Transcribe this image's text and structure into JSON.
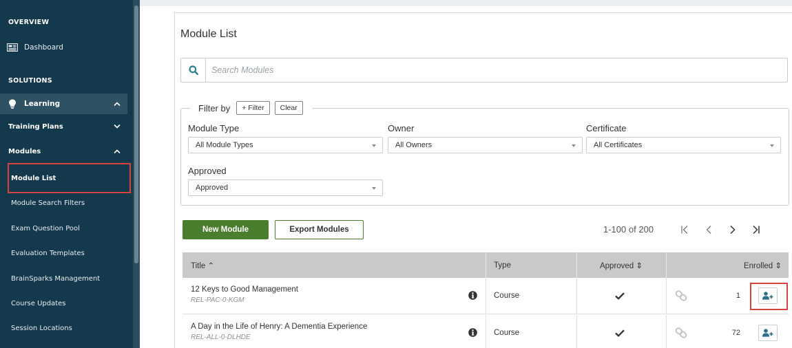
{
  "sidebar": {
    "overview_heading": "OVERVIEW",
    "dashboard_label": "Dashboard",
    "solutions_heading": "SOLUTIONS",
    "learning_label": "Learning",
    "training_plans_label": "Training Plans",
    "modules_label": "Modules",
    "items": [
      {
        "label": "Module List"
      },
      {
        "label": "Module Search Filters"
      },
      {
        "label": "Exam Question Pool"
      },
      {
        "label": "Evaluation Templates"
      },
      {
        "label": "BrainSparks Management"
      },
      {
        "label": "Course Updates"
      },
      {
        "label": "Session Locations"
      }
    ]
  },
  "page": {
    "title": "Module List"
  },
  "search": {
    "placeholder": "Search Modules"
  },
  "filters": {
    "legend": "Filter by",
    "add_filter_label": "+ Filter",
    "clear_label": "Clear",
    "module_type": {
      "label": "Module Type",
      "value": "All Module Types"
    },
    "owner": {
      "label": "Owner",
      "value": "All Owners"
    },
    "certificate": {
      "label": "Certificate",
      "value": "All Certificates"
    },
    "approved": {
      "label": "Approved",
      "value": "Approved"
    }
  },
  "actions": {
    "new_module_label": "New Module",
    "export_label": "Export Modules"
  },
  "pagination": {
    "range_text": "1-100 of 200"
  },
  "table": {
    "headers": {
      "title": "Title ⌃",
      "type": "Type",
      "approved": "Approved ⇕",
      "enrolled": "Enrolled ⇕"
    },
    "rows": [
      {
        "title": "12 Keys to Good Management",
        "code": "REL-PAC-0-KGM",
        "type": "Course",
        "approved": true,
        "enrolled": "1"
      },
      {
        "title": "A Day in the Life of Henry: A Dementia Experience",
        "code": "REL-ALL-0-DLHDE",
        "type": "Course",
        "approved": true,
        "enrolled": "72"
      }
    ]
  },
  "colors": {
    "sidebar_bg": "#14394d",
    "sidebar_active_bg": "#2e5163",
    "primary_green": "#4a7d2e",
    "highlight_red": "#d9433f",
    "table_header_bg": "#c9c9c9",
    "enroll_icon": "#2f6f8c"
  }
}
